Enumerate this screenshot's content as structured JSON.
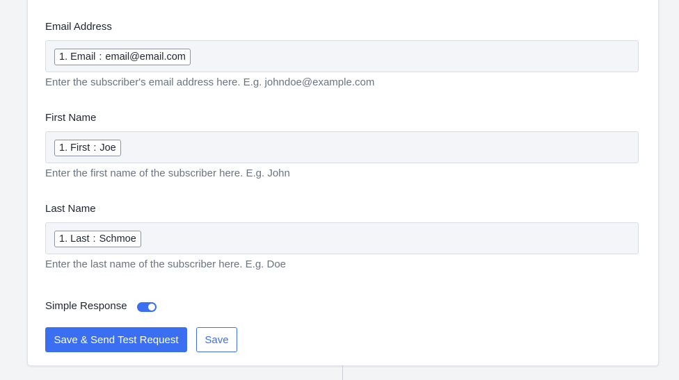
{
  "fields": [
    {
      "label": "Email Address",
      "token": {
        "index": "1.",
        "name": "Email",
        "separator": ":",
        "value": "email@email.com"
      },
      "help": "Enter the subscriber's email address here. E.g. johndoe@example.com"
    },
    {
      "label": "First Name",
      "token": {
        "index": "1.",
        "name": "First",
        "separator": ":",
        "value": "Joe"
      },
      "help": "Enter the first name of the subscriber here. E.g. John"
    },
    {
      "label": "Last Name",
      "token": {
        "index": "1.",
        "name": "Last",
        "separator": ":",
        "value": "Schmoe"
      },
      "help": "Enter the last name of the subscriber here. E.g. Doe"
    }
  ],
  "simple_response": {
    "label": "Simple Response",
    "enabled": true
  },
  "actions": {
    "save_and_test_label": "Save & Send Test Request",
    "save_label": "Save"
  },
  "colors": {
    "accent": "#3b6ff2",
    "help_text": "#6b7280",
    "field_background": "#f3f5f8"
  }
}
